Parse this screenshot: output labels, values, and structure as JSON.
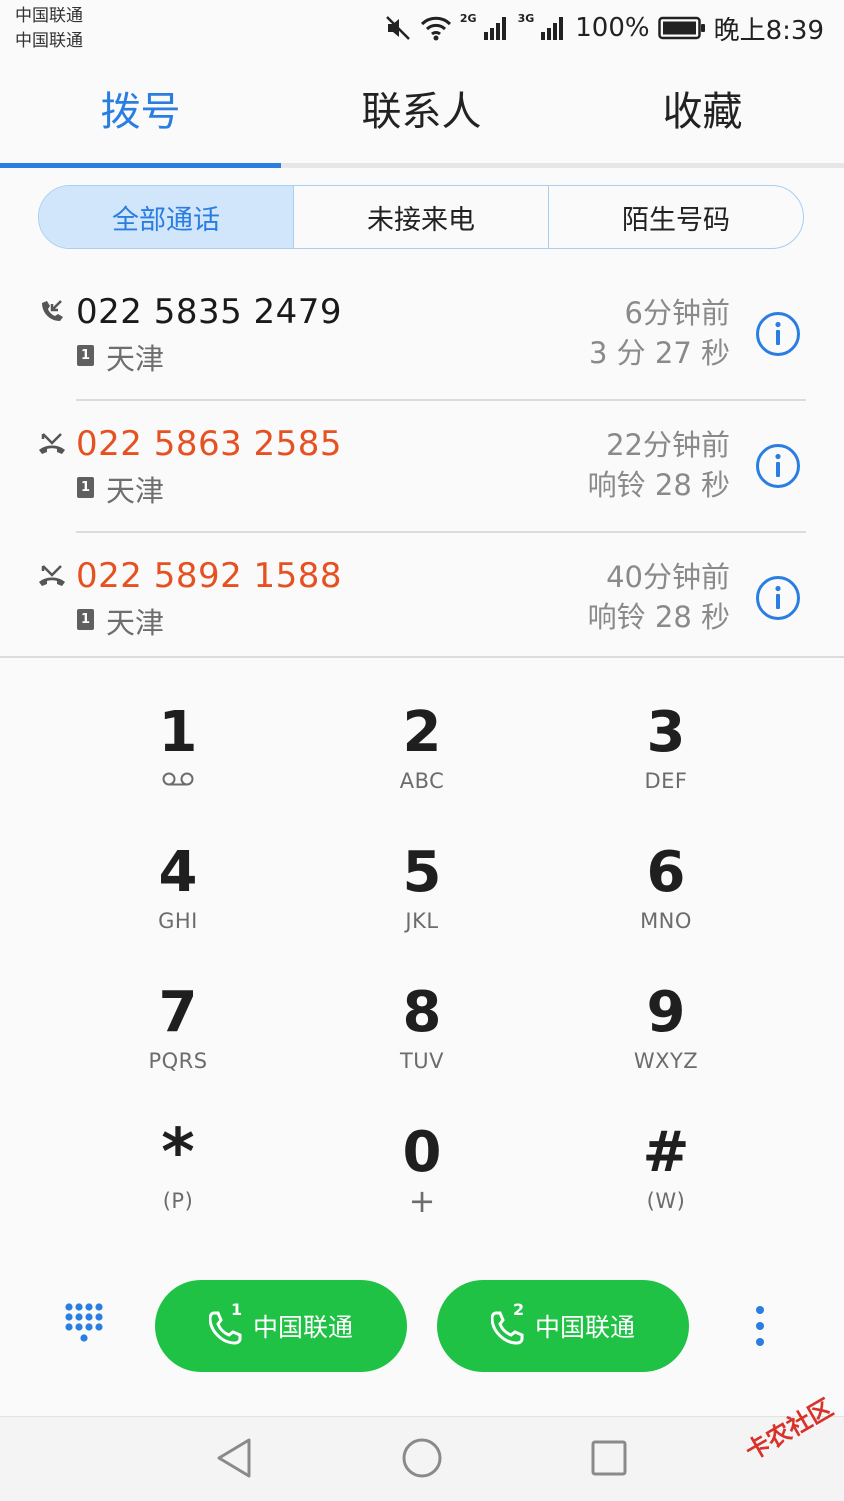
{
  "status_bar": {
    "carrier1": "中国联通",
    "carrier2": "中国联通",
    "net1": "2G",
    "net2": "3G",
    "battery": "100%",
    "time": "晚上8:39"
  },
  "tabs": [
    {
      "label": "拨号"
    },
    {
      "label": "联系人"
    },
    {
      "label": "收藏"
    }
  ],
  "filters": [
    {
      "label": "全部通话"
    },
    {
      "label": "未接来电"
    },
    {
      "label": "陌生号码"
    }
  ],
  "calls": [
    {
      "number": "022 5835 2479",
      "sim": "1",
      "location": "天津",
      "time": "6分钟前",
      "duration": "3 分 27 秒",
      "type": "incoming"
    },
    {
      "number": "022 5863 2585",
      "sim": "1",
      "location": "天津",
      "time": "22分钟前",
      "duration": "响铃 28 秒",
      "type": "missed"
    },
    {
      "number": "022 5892 1588",
      "sim": "1",
      "location": "天津",
      "time": "40分钟前",
      "duration": "响铃 28 秒",
      "type": "missed"
    }
  ],
  "keypad": {
    "k1": {
      "digit": "1"
    },
    "k2": {
      "digit": "2",
      "letters": "ABC"
    },
    "k3": {
      "digit": "3",
      "letters": "DEF"
    },
    "k4": {
      "digit": "4",
      "letters": "GHI"
    },
    "k5": {
      "digit": "5",
      "letters": "JKL"
    },
    "k6": {
      "digit": "6",
      "letters": "MNO"
    },
    "k7": {
      "digit": "7",
      "letters": "PQRS"
    },
    "k8": {
      "digit": "8",
      "letters": "TUV"
    },
    "k9": {
      "digit": "9",
      "letters": "WXYZ"
    },
    "kstar": {
      "digit": "*",
      "letters": "(P)"
    },
    "k0": {
      "digit": "0",
      "letters": "+"
    },
    "khash": {
      "digit": "#",
      "letters": "(W)"
    }
  },
  "actions": {
    "sim1": {
      "label": "中国联通",
      "sim": "1"
    },
    "sim2": {
      "label": "中国联通",
      "sim": "2"
    }
  },
  "watermark": "卡农社区",
  "colors": {
    "accent": "#2a7de1",
    "missed": "#e65122",
    "call_button": "#1fc244"
  }
}
